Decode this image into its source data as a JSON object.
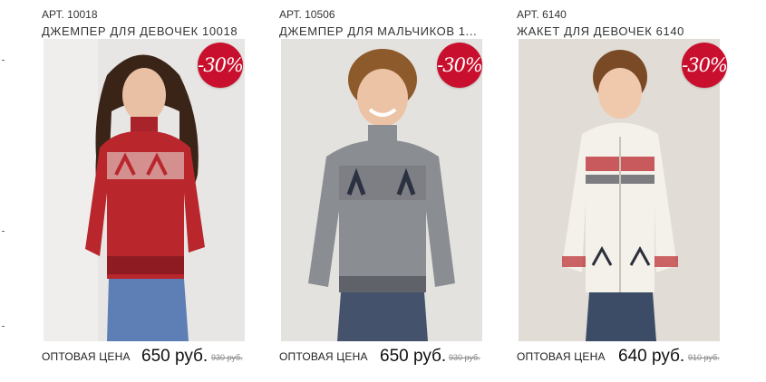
{
  "products": [
    {
      "art": "АРТ. 10018",
      "title": "ДЖЕМПЕР ДЛЯ ДЕВОЧЕК 10018",
      "discount": "-30%",
      "price_label": "ОПТОВАЯ ЦЕНА",
      "price_new": "650 руб.",
      "price_old": "930 руб."
    },
    {
      "art": "АРТ. 10506",
      "title": "ДЖЕМПЕР ДЛЯ МАЛЬЧИКОВ 1...",
      "discount": "-30%",
      "price_label": "ОПТОВАЯ ЦЕНА",
      "price_new": "650 руб.",
      "price_old": "930 руб."
    },
    {
      "art": "АРТ. 6140",
      "title": "ЖАКЕТ ДЛЯ ДЕВОЧЕК 6140",
      "discount": "-30%",
      "price_label": "ОПТОВАЯ ЦЕНА",
      "price_new": "640 руб.",
      "price_old": "910 руб."
    }
  ],
  "colors": {
    "badge": "#c8102e",
    "sweater_red": "#b9262c",
    "sweater_grey": "#8a8d92",
    "jacket_cream": "#f4f1ea"
  }
}
